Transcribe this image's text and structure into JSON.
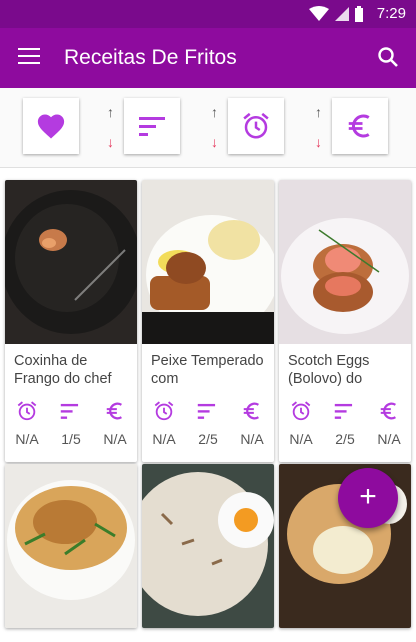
{
  "status_bar": {
    "time": "7:29",
    "icons": [
      "wifi-icon",
      "signal-icon",
      "battery-icon"
    ]
  },
  "app_bar": {
    "title": "Receitas De Fritos",
    "menu_icon": "menu-icon",
    "search_icon": "search-icon"
  },
  "filters": [
    {
      "name": "favorites",
      "icon": "heart-icon",
      "sortable": false
    },
    {
      "name": "difficulty",
      "icon": "sort-icon",
      "sortable": true,
      "up": "↑",
      "down": "↓"
    },
    {
      "name": "time",
      "icon": "alarm-icon",
      "sortable": true,
      "up": "↑",
      "down": "↓"
    },
    {
      "name": "cost",
      "icon": "euro-icon",
      "sortable": true,
      "up": "↑",
      "down": "↓"
    }
  ],
  "recipes": [
    {
      "name": "Coxinha de Frango do chef",
      "time": "N/A",
      "difficulty": "1/5",
      "cost": "N/A"
    },
    {
      "name": "Peixe Temperado com",
      "time": "N/A",
      "difficulty": "2/5",
      "cost": "N/A"
    },
    {
      "name": "Scotch Eggs (Bolovo) do",
      "time": "N/A",
      "difficulty": "2/5",
      "cost": "N/A"
    },
    {
      "name": "",
      "time": "",
      "difficulty": "",
      "cost": ""
    },
    {
      "name": "",
      "time": "",
      "difficulty": "",
      "cost": ""
    },
    {
      "name": "",
      "time": "",
      "difficulty": "",
      "cost": ""
    }
  ],
  "fab": {
    "label": "+"
  },
  "colors": {
    "primary": "#8e0b9e",
    "status_bar": "#7a0a8c",
    "accent_icon": "#b43be0",
    "sort_down": "#e53a5e"
  }
}
